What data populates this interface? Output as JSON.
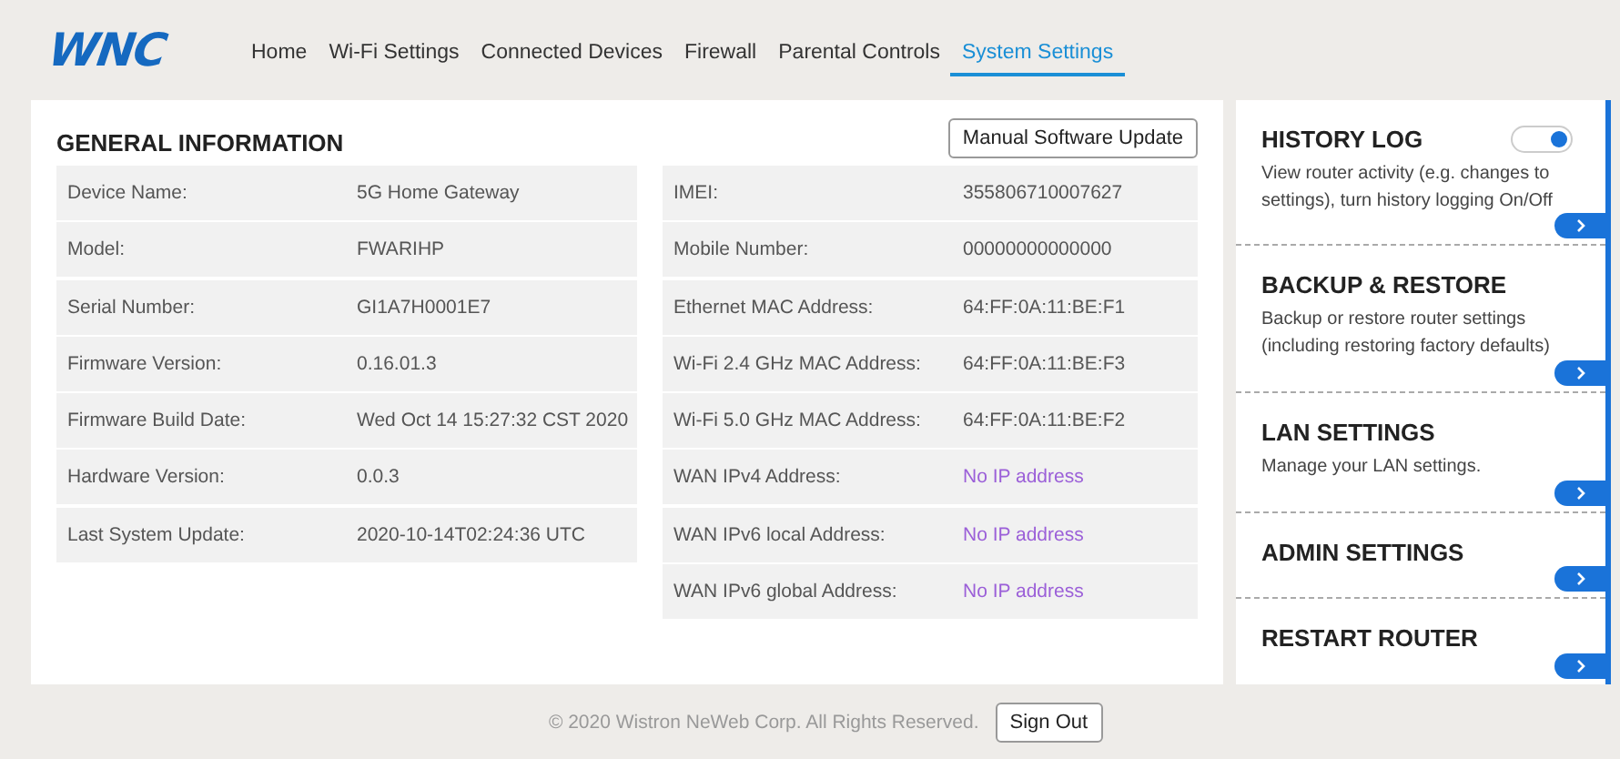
{
  "logo": "WNC",
  "nav": [
    {
      "label": "Home",
      "selected": false
    },
    {
      "label": "Wi-Fi Settings",
      "selected": false
    },
    {
      "label": "Connected Devices",
      "selected": false
    },
    {
      "label": "Firewall",
      "selected": false
    },
    {
      "label": "Parental Controls",
      "selected": false
    },
    {
      "label": "System Settings",
      "selected": true
    }
  ],
  "general": {
    "title": "GENERAL INFORMATION",
    "button": "Manual Software Update",
    "left": [
      {
        "label": "Device Name:",
        "value": "5G Home Gateway",
        "kind": "plain"
      },
      {
        "label": "Model:",
        "value": "FWARIHP",
        "kind": "plain"
      },
      {
        "label": "Serial Number:",
        "value": "GI1A7H0001E7",
        "kind": "plain"
      },
      {
        "label": "Firmware Version:",
        "value": "0.16.01.3",
        "kind": "plain"
      },
      {
        "label": "Firmware Build Date:",
        "value": "Wed Oct 14 15:27:32 CST 2020",
        "kind": "plain"
      },
      {
        "label": "Hardware Version:",
        "value": "0.0.3",
        "kind": "plain"
      },
      {
        "label": "Last System Update:",
        "value": "2020-10-14T02:24:36 UTC",
        "kind": "plain"
      }
    ],
    "right": [
      {
        "label": "IMEI:",
        "value": "355806710007627",
        "kind": "plain"
      },
      {
        "label": "Mobile Number:",
        "value": "00000000000000",
        "kind": "plain"
      },
      {
        "label": "Ethernet MAC Address:",
        "value": "64:FF:0A:11:BE:F1",
        "kind": "plain"
      },
      {
        "label": "Wi-Fi 2.4 GHz MAC Address:",
        "value": "64:FF:0A:11:BE:F3",
        "kind": "plain"
      },
      {
        "label": "Wi-Fi 5.0 GHz MAC Address:",
        "value": "64:FF:0A:11:BE:F2",
        "kind": "plain"
      },
      {
        "label": "WAN IPv4 Address:",
        "value": "No IP address",
        "kind": "unavailable"
      },
      {
        "label": "WAN IPv6 local Address:",
        "value": "No IP address",
        "kind": "unavailable"
      },
      {
        "label": "WAN IPv6 global Address:",
        "value": "No IP address",
        "kind": "unavailable"
      }
    ]
  },
  "settings": [
    {
      "title": "HISTORY LOG",
      "description": "View router activity (e.g. changes to settings), turn history logging On/Off",
      "toggle": {
        "on": true
      }
    },
    {
      "title": "BACKUP & RESTORE",
      "description": "Backup or restore router settings (including restoring factory defaults)"
    },
    {
      "title": "LAN SETTINGS",
      "description": "Manage your LAN settings."
    },
    {
      "title": "ADMIN SETTINGS"
    },
    {
      "title": "RESTART ROUTER"
    }
  ],
  "footer": {
    "copyright": "© 2020 Wistron NeWeb Corp. All Rights Reserved.",
    "button": "Sign Out"
  }
}
